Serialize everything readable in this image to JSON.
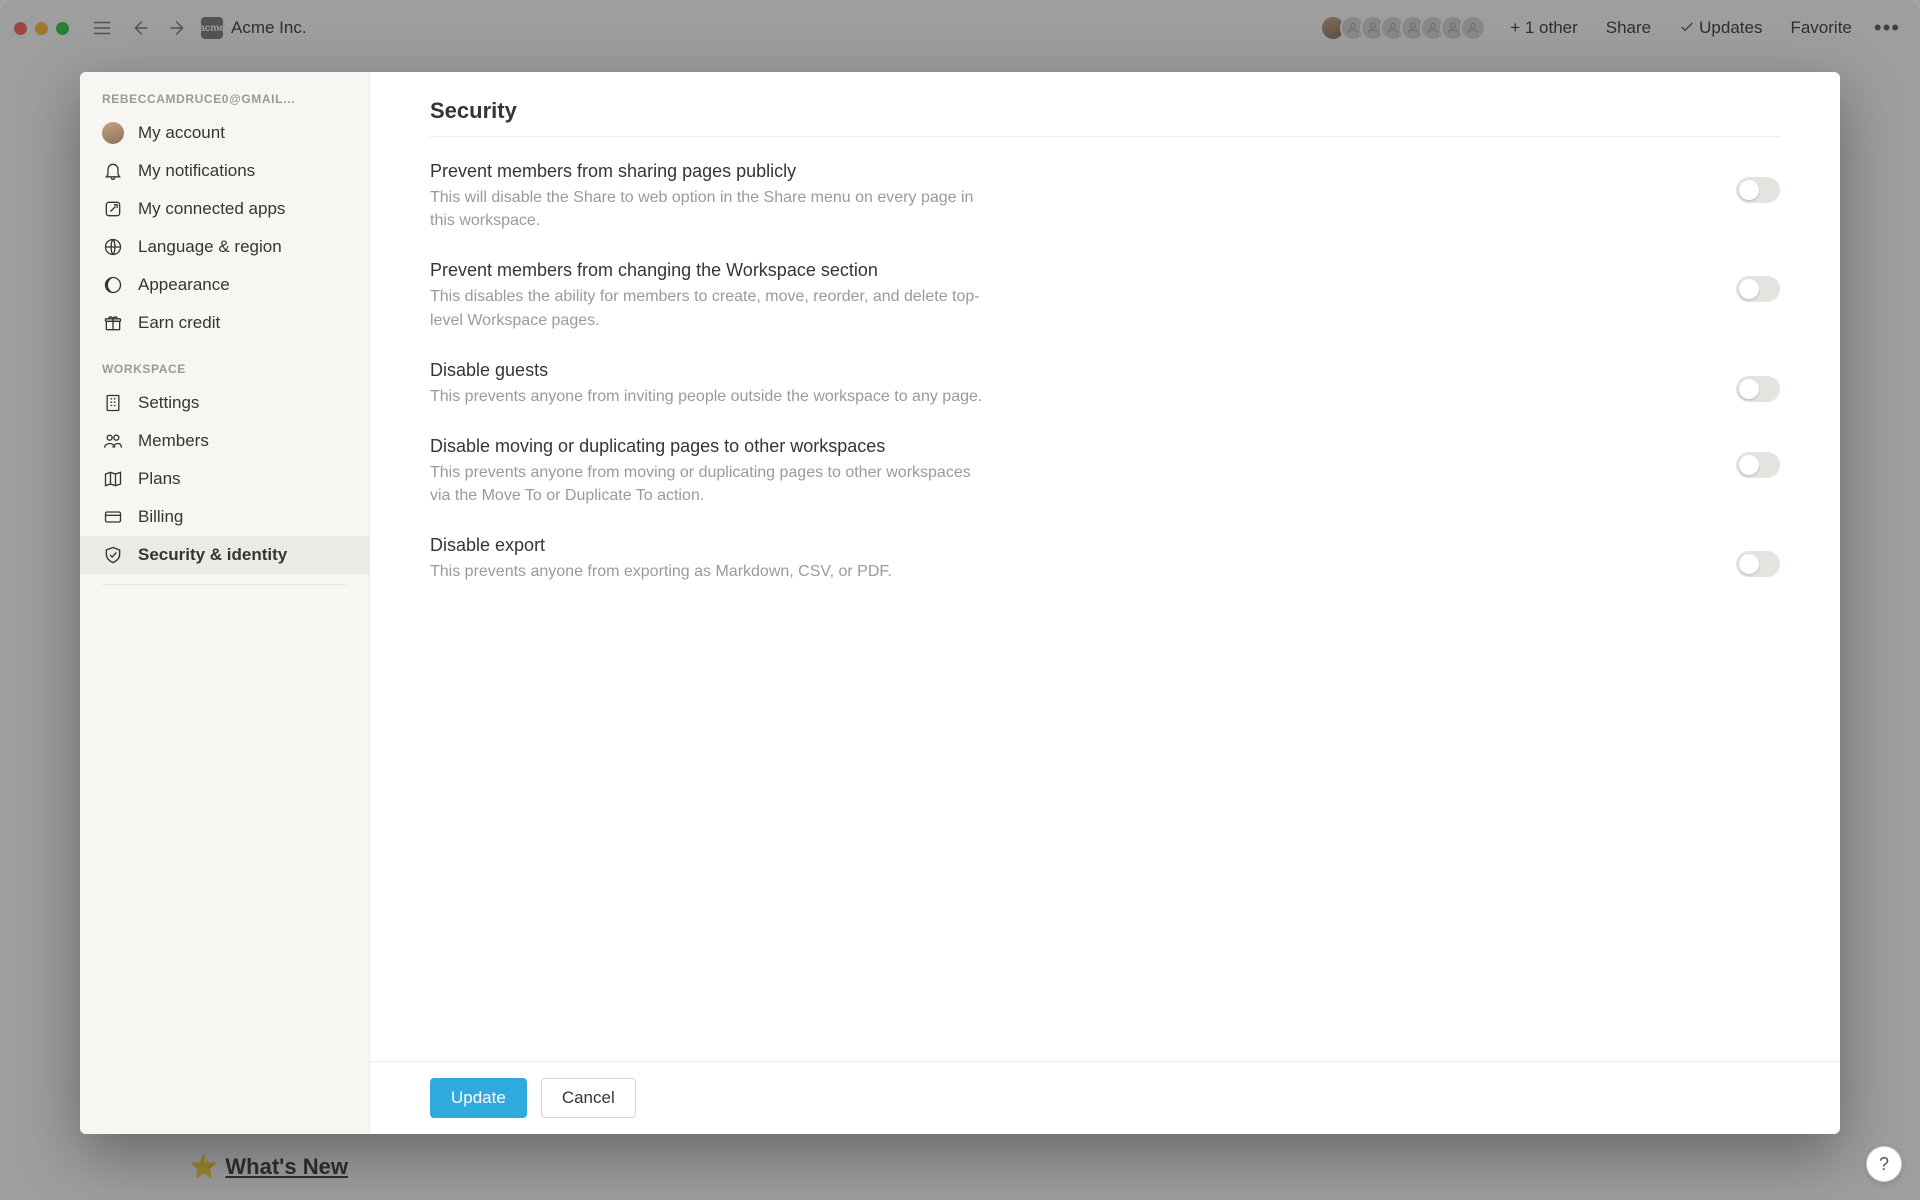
{
  "topbar": {
    "workspace_name": "Acme Inc.",
    "workspace_icon_text": "acme",
    "presence_extra": "+ 1 other",
    "links": {
      "share": "Share",
      "updates": "Updates",
      "favorite": "Favorite"
    }
  },
  "background_page": {
    "icon": "⭐",
    "title": "What's New"
  },
  "help_fab": "?",
  "sidebar": {
    "account_header": "REBECCAMDRUCE0@GMAIL…",
    "workspace_header": "WORKSPACE",
    "items_account": [
      {
        "icon": "avatar",
        "label": "My account"
      },
      {
        "icon": "bell",
        "label": "My notifications"
      },
      {
        "icon": "link",
        "label": "My connected apps"
      },
      {
        "icon": "globe",
        "label": "Language & region"
      },
      {
        "icon": "moon",
        "label": "Appearance"
      },
      {
        "icon": "gift",
        "label": "Earn credit"
      }
    ],
    "items_workspace": [
      {
        "icon": "building",
        "label": "Settings"
      },
      {
        "icon": "people",
        "label": "Members"
      },
      {
        "icon": "map",
        "label": "Plans"
      },
      {
        "icon": "card",
        "label": "Billing"
      },
      {
        "icon": "shield",
        "label": "Security & identity",
        "active": true
      }
    ]
  },
  "page": {
    "title": "Security",
    "settings": [
      {
        "label": "Prevent members from sharing pages publicly",
        "desc": "This will disable the Share to web option in the Share menu on every page in this workspace.",
        "on": false
      },
      {
        "label": "Prevent members from changing the Workspace section",
        "desc": "This disables the ability for members to create, move, reorder, and delete top-level Workspace pages.",
        "on": false
      },
      {
        "label": "Disable guests",
        "desc": "This prevents anyone from inviting people outside the workspace to any page.",
        "on": false
      },
      {
        "label": "Disable moving or duplicating pages to other workspaces",
        "desc": "This prevents anyone from moving or duplicating pages to other workspaces via the Move To or Duplicate To action.",
        "on": false
      },
      {
        "label": "Disable export",
        "desc": "This prevents anyone from exporting as Markdown, CSV, or PDF.",
        "on": false
      }
    ],
    "buttons": {
      "update": "Update",
      "cancel": "Cancel"
    }
  }
}
